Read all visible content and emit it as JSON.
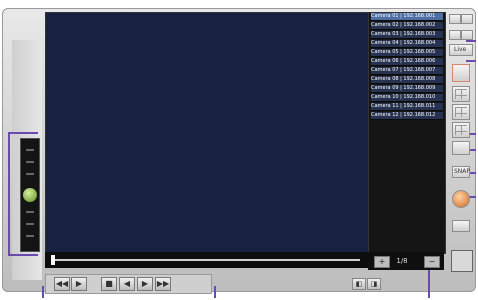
{
  "camera_list": {
    "items": [
      "Camera 01 | 192.168.001",
      "Camera 02 | 192.168.002",
      "Camera 03 | 192.168.003",
      "Camera 04 | 192.168.004",
      "Camera 05 | 192.168.005",
      "Camera 06 | 192.168.006",
      "Camera 07 | 192.168.007",
      "Camera 08 | 192.168.008",
      "Camera 09 | 192.168.009",
      "Camera 10 | 192.168.010",
      "Camera 11 | 192.168.011",
      "Camera 12 | 192.168.012"
    ],
    "selected_index": 0
  },
  "right_toolbar": {
    "minimize_label": "_",
    "close_label": "x",
    "mode_button_label": "Live",
    "layout_icons": [
      "layout-1x1",
      "layout-2x2",
      "layout-3x3",
      "layout-4x4"
    ],
    "snapshot_label": "SNAP",
    "record_label": "REC"
  },
  "playback": {
    "readout": "1/8",
    "position": 0.0
  },
  "controls": {
    "buttons": [
      "◀◀",
      "▶",
      "■",
      "◀",
      "▶",
      "▶▶"
    ]
  },
  "bottom": {
    "misc_buttons": [
      "◧",
      "◨"
    ]
  },
  "colors": {
    "video_bg": "#192142",
    "list_bg": "#151515",
    "annotation": "#6a49b0"
  }
}
